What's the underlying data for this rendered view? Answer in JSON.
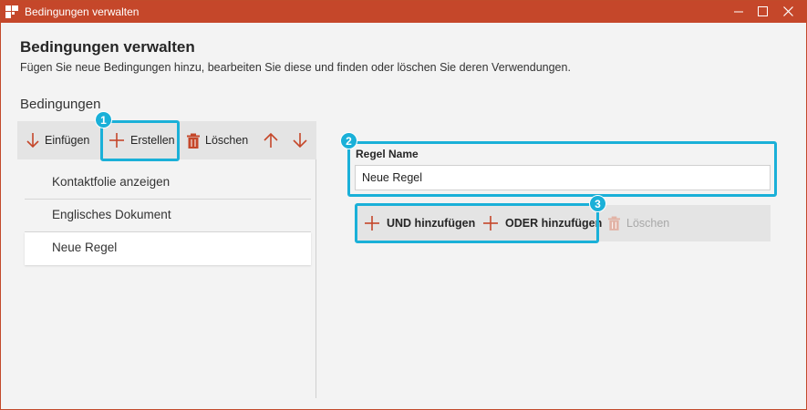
{
  "window": {
    "title": "Bedingungen verwalten"
  },
  "header": {
    "title": "Bedingungen verwalten",
    "description": "Fügen Sie neue Bedingungen hinzu, bearbeiten Sie diese und finden oder löschen Sie deren Verwendungen."
  },
  "conditions": {
    "section_label": "Bedingungen",
    "toolbar": {
      "insert_label": "Einfügen",
      "create_label": "Erstellen",
      "delete_label": "Löschen"
    },
    "items": [
      {
        "label": "Kontaktfolie anzeigen"
      },
      {
        "label": "Englisches Dokument"
      },
      {
        "label": "Neue Regel"
      }
    ],
    "selected": "Neue Regel"
  },
  "rule": {
    "name_label": "Regel Name",
    "name_value": "Neue Regel",
    "toolbar": {
      "add_and_label": "UND hinzufügen",
      "add_or_label": "ODER hinzufügen",
      "delete_label": "Löschen"
    }
  },
  "callouts": [
    "1",
    "2",
    "3"
  ],
  "colors": {
    "accent": "#c5472a",
    "callout": "#1ab0d8",
    "icon_red": "#c5472a"
  }
}
